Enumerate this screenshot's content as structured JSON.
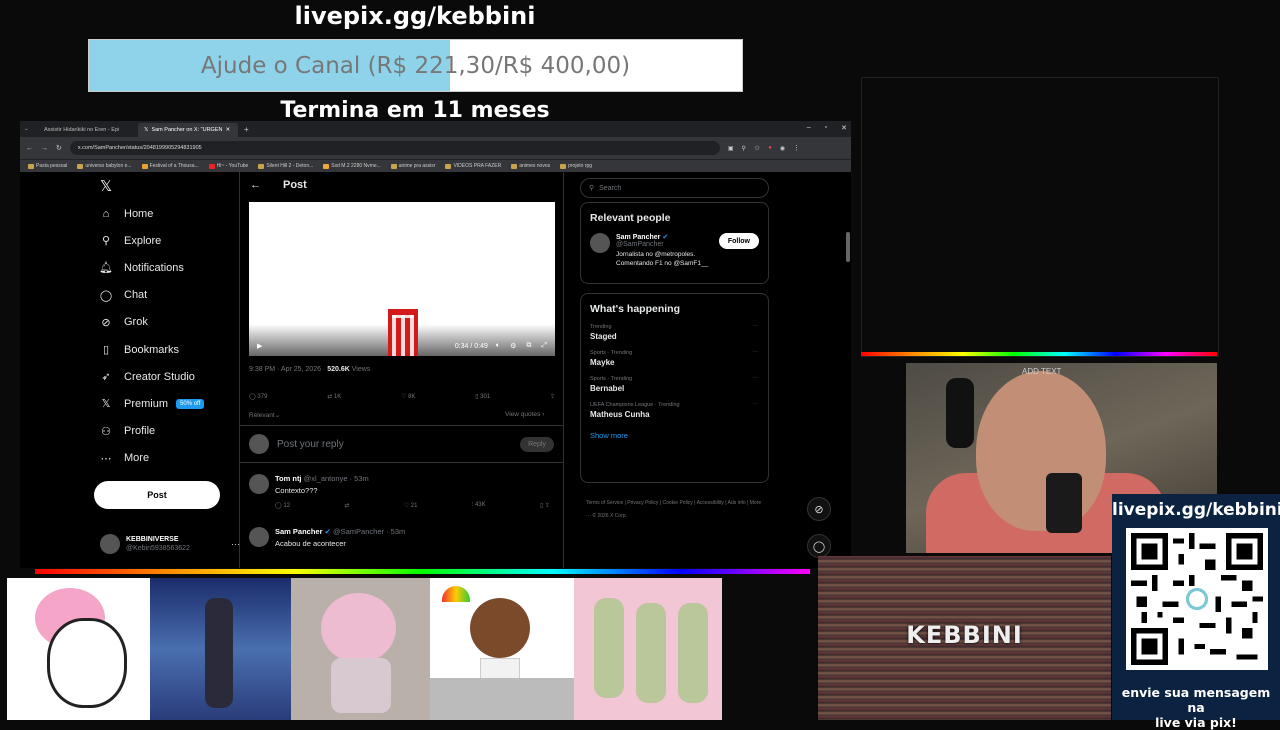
{
  "overlay": {
    "livepix_top": "livepix.gg/kebbini",
    "goal_text": "Ajude o Canal (R$ 221,30/R$ 400,00)",
    "goal_progress": 0.553,
    "goal_end": "Termina em 11 meses"
  },
  "browser": {
    "tabs": [
      {
        "label": "Assistir Hidarikiki no Eren - Epi"
      },
      {
        "label": "Sam Pancher on X: \"URGEN"
      }
    ],
    "url": "x.com/SamPancher/status/2048199905294831905",
    "bookmarks": [
      "Pasta pessoal",
      "universo babylon e...",
      "Festival of a Thousa...",
      "Hi~ - YouTube",
      "Silent Hill 2 - Deton...",
      "Ssd M.2 2280 Nvme...",
      "anime pra assisr",
      "VIDEOS PRA FAZER",
      "animes novos",
      "projeto rpg"
    ]
  },
  "nav": {
    "items": [
      {
        "label": "Home",
        "icon": "home-icon",
        "glyph": "⌂"
      },
      {
        "label": "Explore",
        "icon": "search-icon",
        "glyph": "⚲"
      },
      {
        "label": "Notifications",
        "icon": "bell-icon",
        "glyph": "🔔︎"
      },
      {
        "label": "Chat",
        "icon": "chat-icon",
        "glyph": "◯"
      },
      {
        "label": "Grok",
        "icon": "grok-icon",
        "glyph": "⊘"
      },
      {
        "label": "Bookmarks",
        "icon": "bookmark-icon",
        "glyph": "▯"
      },
      {
        "label": "Creator Studio",
        "icon": "rocket-icon",
        "glyph": "➶"
      },
      {
        "label": "Premium",
        "icon": "x-icon",
        "glyph": "𝕏"
      },
      {
        "label": "Profile",
        "icon": "person-icon",
        "glyph": "⚇"
      },
      {
        "label": "More",
        "icon": "more-icon",
        "glyph": "⋯"
      }
    ],
    "premium_badge": "50% off",
    "post_button": "Post",
    "account_name": "KEBBINIVERSE",
    "account_handle": "@Kebin5938563622"
  },
  "post": {
    "header": "Post",
    "video_time": "0:34 / 0:49",
    "timestamp": "9:38 PM · Apr 25, 2026 · ",
    "views_count": "520.6K",
    "views_label": "Views",
    "replies": "379",
    "reposts": "1K",
    "likes": "8K",
    "bookmarks": "301",
    "relevant": "Relevant",
    "view_quotes": "View quotes",
    "reply_placeholder": "Post your reply",
    "reply_button": "Reply"
  },
  "replies": [
    {
      "name": "Tom ntj",
      "handle": "@xl_antonye · 53m",
      "text": "Contexto???",
      "replies": "12",
      "likes": "21",
      "views": "43K"
    },
    {
      "name": "Sam Pancher",
      "handle": "@SamPancher · 53m",
      "text": "Acabou de acontecer"
    }
  ],
  "sidebar": {
    "search_placeholder": "Search",
    "relevant_title": "Relevant people",
    "person_name": "Sam Pancher",
    "person_handle": "@SamPancher",
    "person_bio_1": "Jornalista no @metropoles.",
    "person_bio_2": "Comentando F1 no @SamF1__",
    "follow": "Follow",
    "happening_title": "What's happening",
    "trends": [
      {
        "meta": "Trending",
        "name": "Staged"
      },
      {
        "meta": "Sports · Trending",
        "name": "Mayke"
      },
      {
        "meta": "Sports · Trending",
        "name": "Bernabel"
      },
      {
        "meta": "UEFA Champions League · Trending",
        "name": "Matheus Cunha"
      }
    ],
    "show_more": "Show more",
    "footer": "Terms of Service  |  Privacy Policy  |  Cookie Policy  |  Accessibility  |  Ads info  |  More ···  © 2026 X Corp."
  },
  "stream": {
    "add_text": "ADD TEXT",
    "kebbini": "KEBBINI",
    "qr_title": "livepix.gg/kebbini",
    "qr_footer_1": "envie sua mensagem na",
    "qr_footer_2": "live via pix!"
  },
  "colors": {
    "accent": "#1d9bf0",
    "goal_fill": "#8fd3ea",
    "qr_panel": "#0b2340"
  }
}
